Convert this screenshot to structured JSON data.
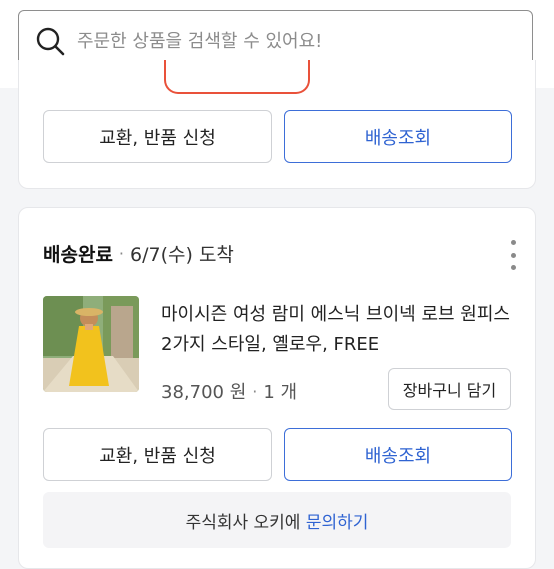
{
  "search": {
    "placeholder": "주문한 상품을 검색할 수 있어요!",
    "icon": "search-icon"
  },
  "card1": {
    "exchange_label": "교환, 반품 신청",
    "tracking_label": "배송조회"
  },
  "card2": {
    "status": "배송완료",
    "separator": "·",
    "date": "6/7(수) 도착",
    "menu_icon": "more-vertical-icon",
    "product": {
      "name": "마이시즌 여성 람미 에스닉 브이넥 로브 원피스 2가지 스타일, 옐로우, FREE",
      "price": "38,700 원",
      "quantity": "1 개",
      "cart_label": "장바구니 담기"
    },
    "exchange_label": "교환, 반품 신청",
    "tracking_label": "배송조회",
    "seller": {
      "prefix": "주식회사 오키에 ",
      "link": "문의하기"
    }
  },
  "colors": {
    "accent": "#2f63d2",
    "border": "#cfd1d5",
    "background": "#f4f5f7"
  }
}
